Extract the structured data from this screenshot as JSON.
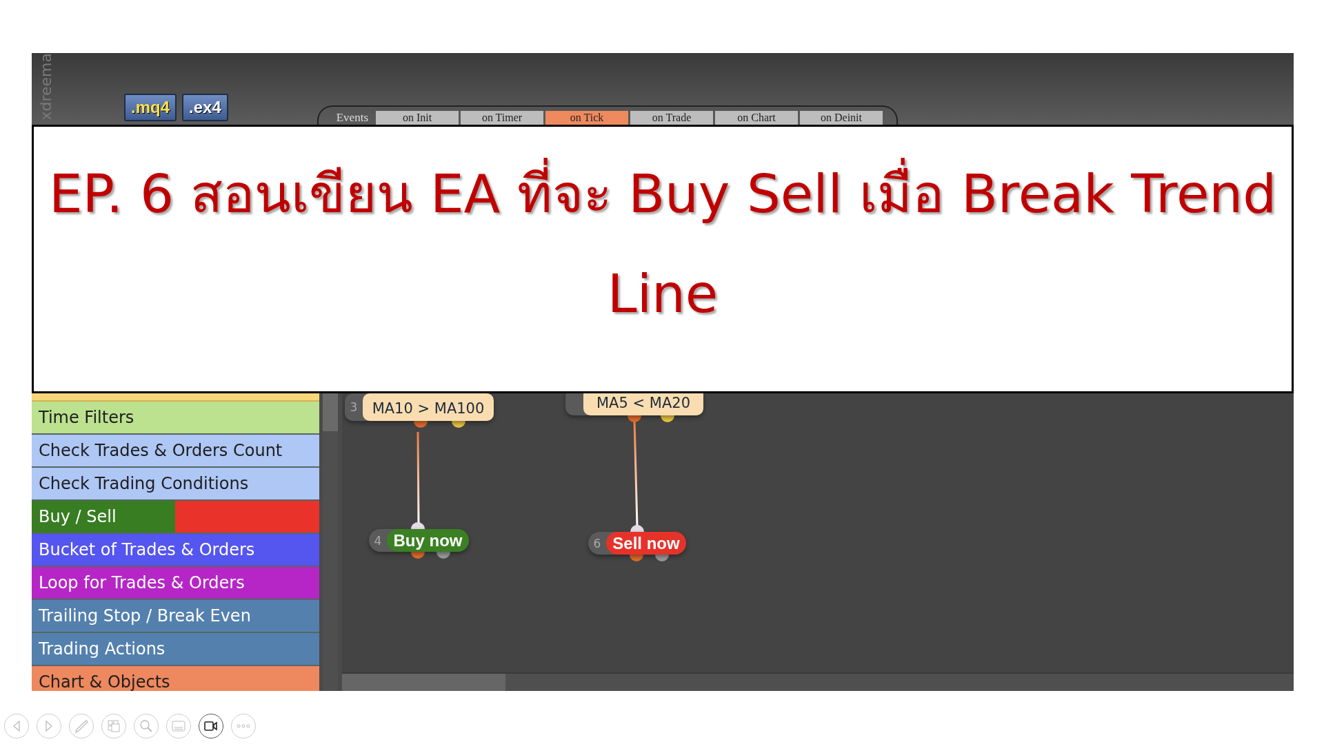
{
  "app": {
    "logo_text": "xdreema",
    "file_buttons": [
      ".mq4",
      ".ex4"
    ],
    "events_label": "Events",
    "event_tabs": [
      {
        "label": "on Init",
        "selected": false
      },
      {
        "label": "on Timer",
        "selected": false
      },
      {
        "label": "on Tick",
        "selected": true
      },
      {
        "label": "on Trade",
        "selected": false
      },
      {
        "label": "on Chart",
        "selected": false
      },
      {
        "label": "on Deinit",
        "selected": false
      }
    ],
    "categories": [
      {
        "label": "Time Filters",
        "kind": "plain",
        "color": "#bce18f"
      },
      {
        "label": "Check Trades & Orders Count",
        "kind": "plain",
        "color": "#aec7f5"
      },
      {
        "label": "Check Trading Conditions",
        "kind": "plain",
        "color": "#aec7f5"
      },
      {
        "label": "Buy / Sell",
        "kind": "split",
        "color": "#387d22"
      },
      {
        "label": "Bucket of Trades & Orders",
        "kind": "plain",
        "color": "#5555f0"
      },
      {
        "label": "Loop for Trades & Orders",
        "kind": "plain",
        "color": "#b626c6"
      },
      {
        "label": "Trailing Stop / Break Even",
        "kind": "plain",
        "color": "#5480ae"
      },
      {
        "label": "Trading Actions",
        "kind": "plain",
        "color": "#5480ae"
      },
      {
        "label": "Chart & Objects",
        "kind": "plain",
        "color": "#ee885e"
      }
    ],
    "nodes": [
      {
        "number": "3",
        "label": "MA10 > MA100",
        "kind": "condition"
      },
      {
        "label": "MA5 < MA20",
        "kind": "condition"
      },
      {
        "number": "4",
        "label": "Buy now",
        "kind": "buy"
      },
      {
        "number": "6",
        "label": "Sell now",
        "kind": "sell"
      }
    ]
  },
  "title": "EP. 6 สอนเขียน EA ที่จะ Buy Sell เมื่อ Break Trend Line"
}
